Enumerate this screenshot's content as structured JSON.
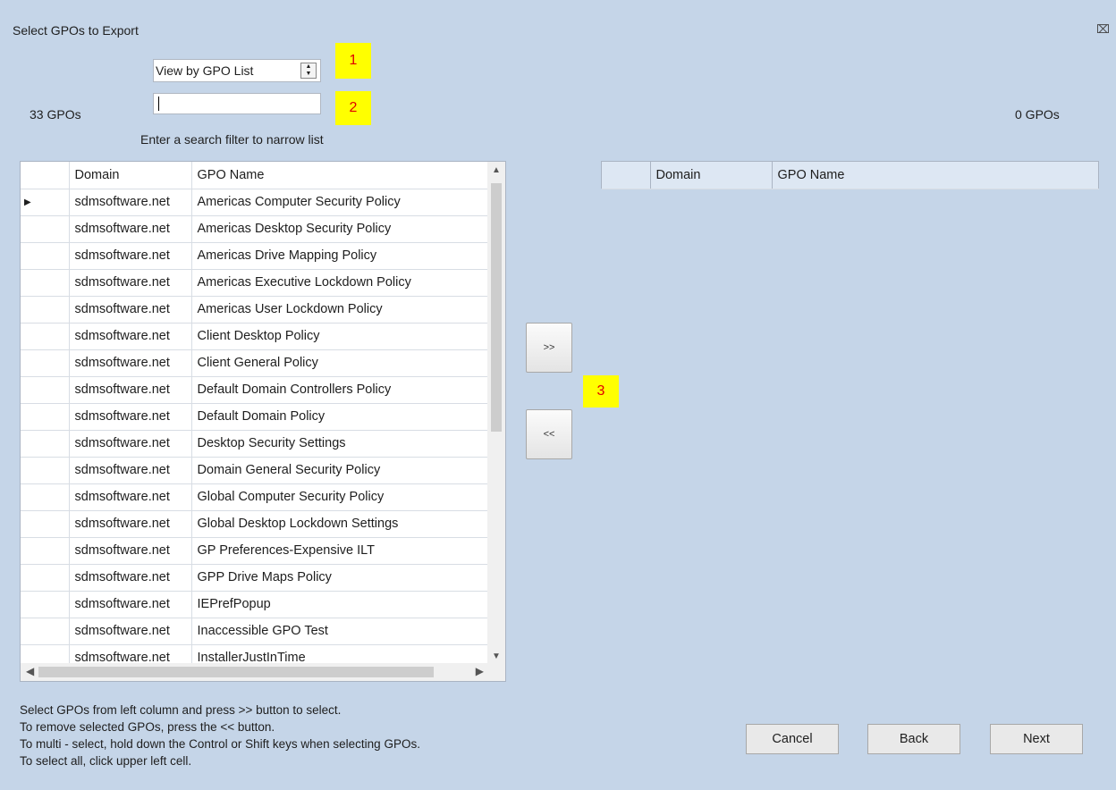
{
  "dialog": {
    "title": "Select GPOs to Export",
    "close_icon": "⌧"
  },
  "view_select": {
    "value": "View by GPO List"
  },
  "search": {
    "value": "",
    "hint": "Enter a search filter to narrow list"
  },
  "callouts": [
    "1",
    "2",
    "3"
  ],
  "left": {
    "count": "33 GPOs",
    "columns": [
      "Domain",
      "GPO Name"
    ],
    "rows": [
      {
        "domain": "sdmsoftware.net",
        "name": "Americas Computer Security Policy"
      },
      {
        "domain": "sdmsoftware.net",
        "name": "Americas Desktop Security Policy"
      },
      {
        "domain": "sdmsoftware.net",
        "name": "Americas Drive Mapping Policy"
      },
      {
        "domain": "sdmsoftware.net",
        "name": "Americas Executive Lockdown Policy"
      },
      {
        "domain": "sdmsoftware.net",
        "name": "Americas User Lockdown Policy"
      },
      {
        "domain": "sdmsoftware.net",
        "name": "Client Desktop Policy"
      },
      {
        "domain": "sdmsoftware.net",
        "name": "Client General Policy"
      },
      {
        "domain": "sdmsoftware.net",
        "name": "Default Domain Controllers Policy"
      },
      {
        "domain": "sdmsoftware.net",
        "name": "Default Domain Policy"
      },
      {
        "domain": "sdmsoftware.net",
        "name": "Desktop Security Settings"
      },
      {
        "domain": "sdmsoftware.net",
        "name": "Domain General Security Policy"
      },
      {
        "domain": "sdmsoftware.net",
        "name": "Global Computer Security Policy"
      },
      {
        "domain": "sdmsoftware.net",
        "name": "Global Desktop Lockdown Settings"
      },
      {
        "domain": "sdmsoftware.net",
        "name": "GP Preferences-Expensive ILT"
      },
      {
        "domain": "sdmsoftware.net",
        "name": "GPP Drive Maps Policy"
      },
      {
        "domain": "sdmsoftware.net",
        "name": "IEPrefPopup"
      },
      {
        "domain": "sdmsoftware.net",
        "name": "Inaccessible GPO Test"
      },
      {
        "domain": "sdmsoftware.net",
        "name": "InstallerJustInTime"
      }
    ]
  },
  "right": {
    "count": "0 GPOs",
    "columns": [
      "Domain",
      "GPO Name"
    ]
  },
  "move_buttons": {
    "add": ">>",
    "remove": "<<"
  },
  "instructions": [
    "Select GPOs from left column and press >> button to select.",
    "To remove selected GPOs, press the << button.",
    "To multi - select, hold down the Control or Shift keys when selecting GPOs.",
    "To select all, click upper left cell."
  ],
  "buttons": {
    "cancel": "Cancel",
    "back": "Back",
    "next": "Next"
  }
}
